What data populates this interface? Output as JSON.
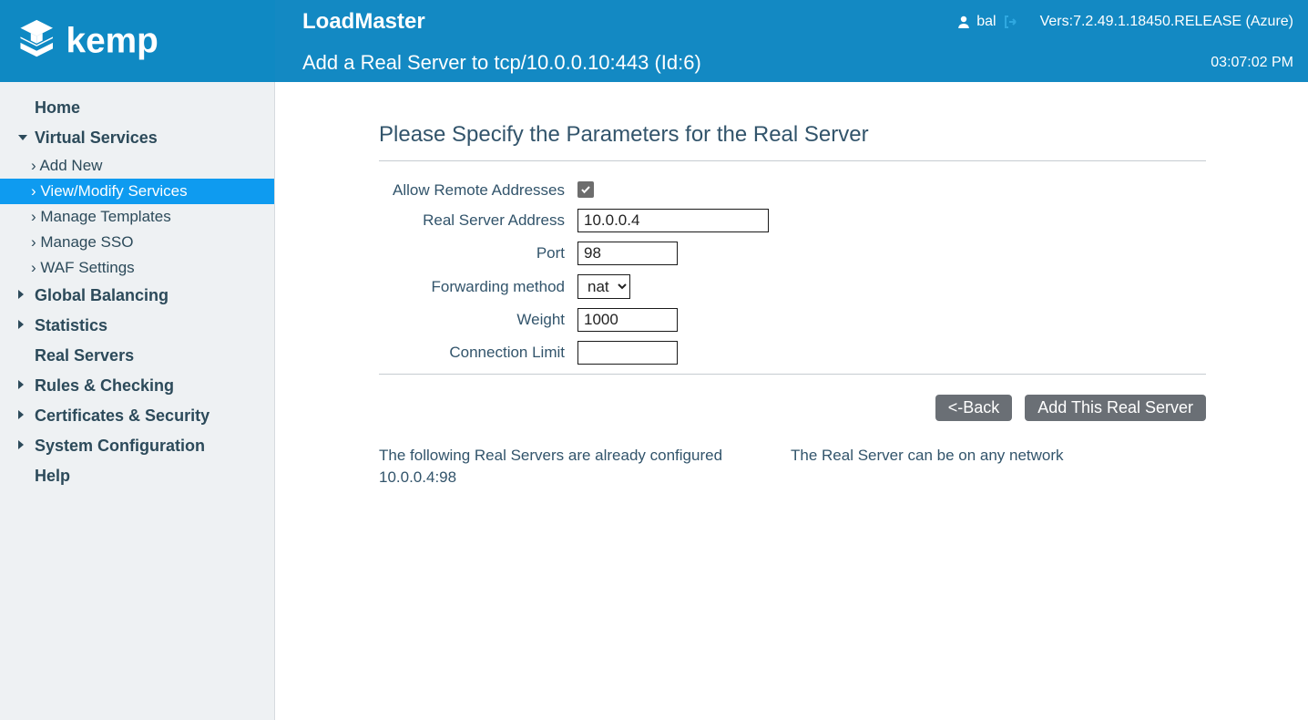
{
  "header": {
    "product": "LoadMaster",
    "user": "bal",
    "version": "Vers:7.2.49.1.18450.RELEASE (Azure)",
    "subtitle": "Add a Real Server to tcp/10.0.0.10:443 (Id:6)",
    "time": "03:07:02 PM"
  },
  "sidebar": {
    "home": "Home",
    "virtual_services": {
      "label": "Virtual Services",
      "items": {
        "add_new": "Add New",
        "view_modify": "View/Modify Services",
        "manage_templates": "Manage Templates",
        "manage_sso": "Manage SSO",
        "waf_settings": "WAF Settings"
      }
    },
    "global_balancing": "Global Balancing",
    "statistics": "Statistics",
    "real_servers": "Real Servers",
    "rules_checking": "Rules & Checking",
    "certs_security": "Certificates & Security",
    "system_config": "System Configuration",
    "help": "Help"
  },
  "main": {
    "title": "Please Specify the Parameters for the Real Server",
    "labels": {
      "allow_remote": "Allow Remote Addresses",
      "address": "Real Server Address",
      "port": "Port",
      "forwarding": "Forwarding method",
      "weight": "Weight",
      "conn_limit": "Connection Limit"
    },
    "values": {
      "allow_remote_checked": true,
      "address": "10.0.0.4",
      "port": "98",
      "forwarding": "nat",
      "weight": "1000",
      "conn_limit": ""
    },
    "buttons": {
      "back": "<-Back",
      "add": "Add This Real Server"
    },
    "notes": {
      "configured_header": "The following Real Servers are already configured",
      "configured_entry": "10.0.0.4:98",
      "network_note": "The Real Server can be on any network"
    }
  }
}
